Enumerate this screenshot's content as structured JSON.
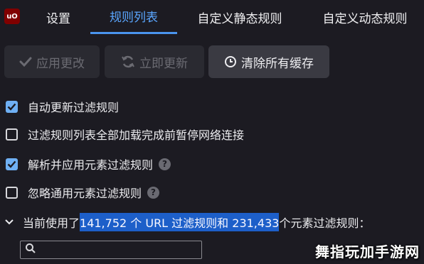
{
  "logo": {
    "text": "uO"
  },
  "tabs": {
    "settings": "设置",
    "rules": "规则列表",
    "static": "自定义静态规则",
    "dynamic": "自定义动态规则"
  },
  "toolbar": {
    "apply": "应用更改",
    "update": "立即更新",
    "purge": "清除所有缓存"
  },
  "options": [
    {
      "label": "自动更新过滤规则",
      "checked": true,
      "help": false
    },
    {
      "label": "过滤规则列表全部加载完成前暂停网络连接",
      "checked": false,
      "help": false
    },
    {
      "label": "解析并应用元素过滤规则",
      "checked": true,
      "help": true
    },
    {
      "label": "忽略通用元素过滤规则",
      "checked": false,
      "help": true
    }
  ],
  "help_glyph": "?",
  "summary": {
    "prefix": "当前使用了 ",
    "highlight": "141,752 个 URL 过滤规则和 231,433",
    "suffix": " 个元素过滤规则："
  },
  "search": {
    "value": "",
    "placeholder": ""
  },
  "watermark": "舞指玩加手游网",
  "colors": {
    "accent": "#4a95ee",
    "highlight": "#1d5fc9",
    "logo": "#800000",
    "checkbox": "#6fb0f4"
  }
}
